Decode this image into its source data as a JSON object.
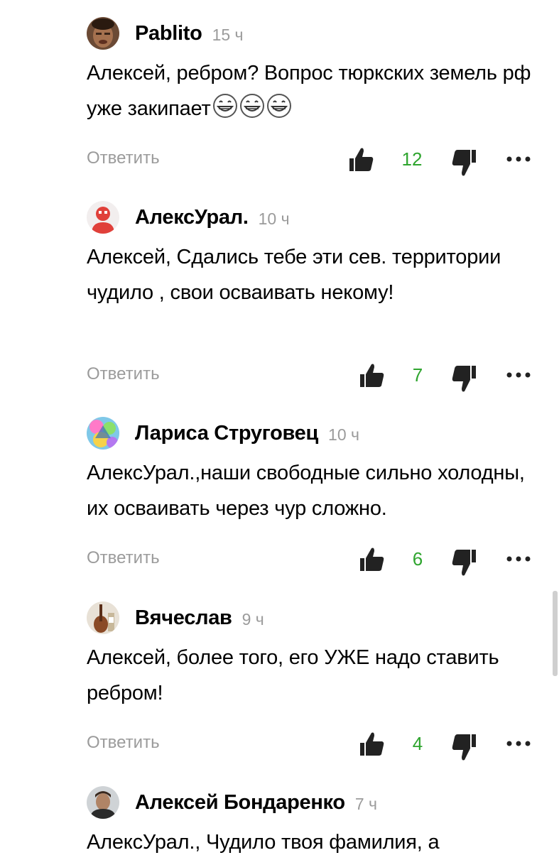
{
  "comments": [
    {
      "author": "Pablito",
      "time": "15 ч",
      "text": "Алексей, ребром? Вопрос тюркских земель рф уже закипает",
      "emoji": "grinning-face-icon",
      "reply_label": "Ответить",
      "likes": "12"
    },
    {
      "author": "АлексУрал.",
      "time": "10 ч",
      "text": "Алексей, Сдались тебе эти сев. территории чудило , свои осваивать некому!",
      "reply_label": "Ответить",
      "likes": "7"
    },
    {
      "author": "Лариса Струговец",
      "time": "10 ч",
      "text": "АлексУрал.,наши свободные сильно холодны, их осваивать через чур сложно.",
      "reply_label": "Ответить",
      "likes": "6"
    },
    {
      "author": "Вячеслав",
      "time": "9 ч",
      "text": "Алексей, более того, его УЖЕ надо ставить ребром!",
      "reply_label": "Ответить",
      "likes": "4"
    },
    {
      "author": "Алексей Бондаренко",
      "time": "7 ч",
      "text": "АлексУрал., Чудило твоя фамилия, а"
    }
  ],
  "colors": {
    "like_count": "#2fa52f",
    "muted": "#9b9b9b",
    "icon": "#222222"
  }
}
